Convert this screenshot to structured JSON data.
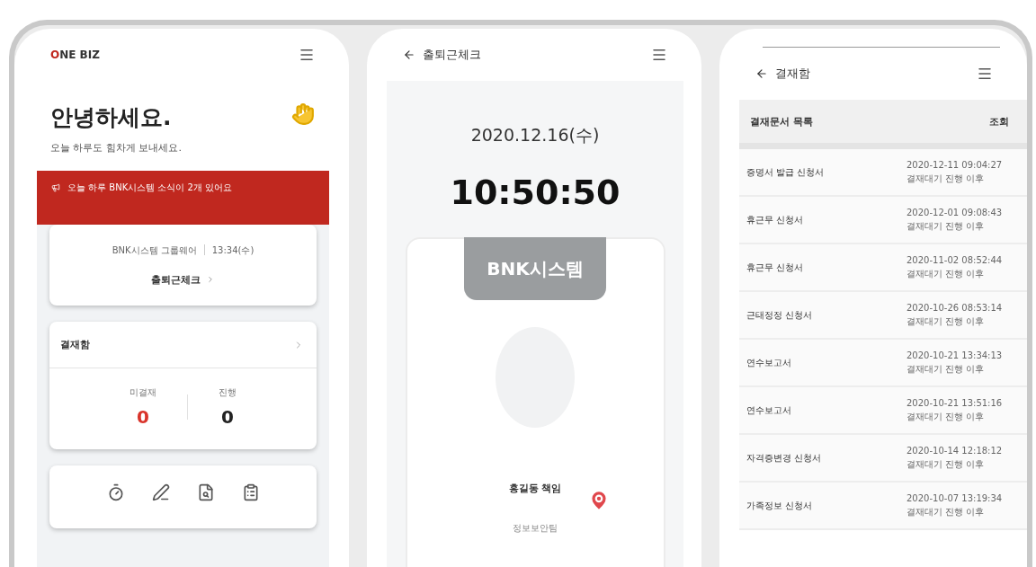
{
  "screens": [
    {
      "kind": "home",
      "logo": {
        "accent": "O",
        "rest": "NE BIZ"
      },
      "greeting": "안녕하세요.",
      "subtitle": "오늘 하루도 힘차게 보내세요.",
      "notice": "오늘 하루 BNK시스템 소식이 2개 있어요",
      "attendance_card": {
        "info": "BNK시스템 그룹웨어",
        "time": "13:34(수)",
        "action": "출퇴근체크"
      },
      "approval_card": {
        "title": "결재함",
        "stats": [
          {
            "label": "미결재",
            "value": "0",
            "alert": true
          },
          {
            "label": "진행",
            "value": "0",
            "alert": false
          }
        ]
      }
    },
    {
      "kind": "check",
      "title": "출퇴근체크",
      "date": "2020.12.16(수)",
      "time": "10:50:50",
      "badge": "BNK시스템",
      "name": "홍길동 책임",
      "department": "정보보안팀"
    },
    {
      "kind": "list",
      "title": "결재함",
      "header": {
        "label": "결재문서 목록",
        "action": "조회"
      },
      "rows": [
        {
          "name": "증명서 발급 신청서",
          "date": "2020-12-11 09:04:27",
          "status": "결재대기 진행 이후"
        },
        {
          "name": "휴근무 신청서",
          "date": "2020-12-01 09:08:43",
          "status": "결재대기 진행 이후"
        },
        {
          "name": "휴근무 신청서",
          "date": "2020-11-02 08:52:44",
          "status": "결재대기 진행 이후"
        },
        {
          "name": "근태정정 신청서",
          "date": "2020-10-26 08:53:14",
          "status": "결재대기 진행 이후"
        },
        {
          "name": "연수보고서",
          "date": "2020-10-21 13:34:13",
          "status": "결재대기 진행 이후"
        },
        {
          "name": "연수보고서",
          "date": "2020-10-21 13:51:16",
          "status": "결재대기 진행 이후"
        },
        {
          "name": "자격증변경 신청서",
          "date": "2020-10-14 12:18:12",
          "status": "결재대기 진행 이후"
        },
        {
          "name": "가족정보 신청서",
          "date": "2020-10-07 13:19:34",
          "status": "결재대기 진행 이후"
        }
      ]
    }
  ]
}
